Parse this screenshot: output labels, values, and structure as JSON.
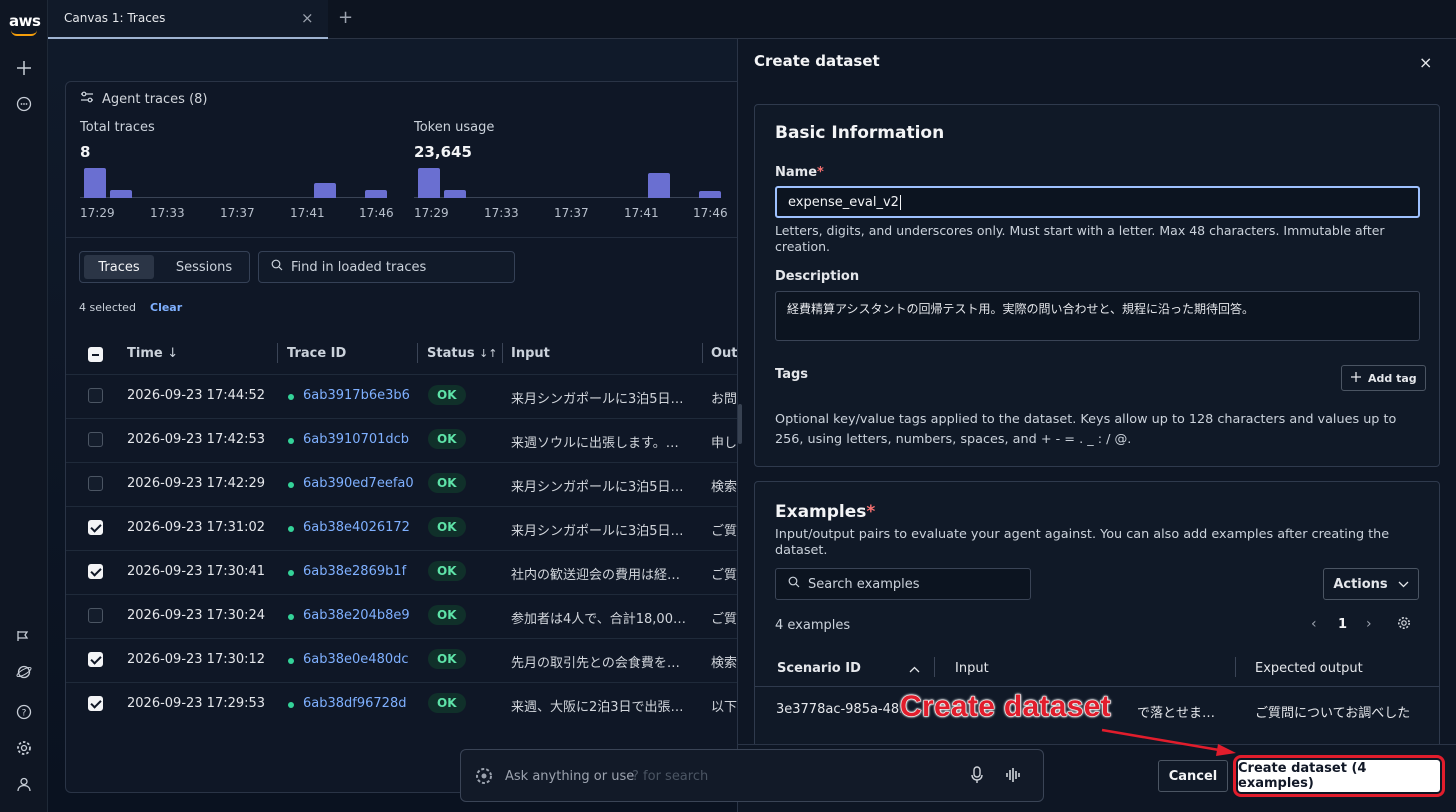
{
  "rail": {
    "logo": "aws",
    "icons": [
      "plus-icon",
      "chat-icon",
      "announce-icon",
      "support-icon",
      "help-icon",
      "settings-icon",
      "user-icon"
    ]
  },
  "tabbar": {
    "tab_title": "Canvas 1: Traces",
    "close": "×",
    "add": "+"
  },
  "traces_panel": {
    "title": "Agent traces (8)",
    "kpis": [
      {
        "label": "Total traces",
        "value": "8"
      },
      {
        "label": "Token usage",
        "value": "23,645"
      }
    ],
    "ticks": [
      "17:29",
      "17:33",
      "17:37",
      "17:41",
      "17:46"
    ],
    "segments": [
      "Traces",
      "Sessions"
    ],
    "search_placeholder": "Find in loaded traces",
    "selected_text": "4 selected",
    "clear_label": "Clear",
    "columns": {
      "time": "Time",
      "trace_id": "Trace ID",
      "status": "Status",
      "input": "Input",
      "output": "Outpu"
    },
    "rows": [
      {
        "time": "2026-09-23 17:44:52",
        "id": "6ab3917b6e3b6",
        "status": "OK",
        "input": "来月シンガポールに3泊5日…",
        "output": "お問",
        "checked": false
      },
      {
        "time": "2026-09-23 17:42:53",
        "id": "6ab3910701dcb",
        "status": "OK",
        "input": "来週ソウルに出張します。…",
        "output": "申し",
        "checked": false
      },
      {
        "time": "2026-09-23 17:42:29",
        "id": "6ab390ed7eefa0",
        "status": "OK",
        "input": "来月シンガポールに3泊5日…",
        "output": "検索",
        "checked": false
      },
      {
        "time": "2026-09-23 17:31:02",
        "id": "6ab38e4026172",
        "status": "OK",
        "input": "来月シンガポールに3泊5日…",
        "output": "ご質",
        "checked": true
      },
      {
        "time": "2026-09-23 17:30:41",
        "id": "6ab38e2869b1f",
        "status": "OK",
        "input": "社内の歓送迎会の費用は経…",
        "output": "ご質",
        "checked": true
      },
      {
        "time": "2026-09-23 17:30:24",
        "id": "6ab38e204b8e9",
        "status": "OK",
        "input": "参加者は4人で、合計18,000…",
        "output": "ご質",
        "checked": false
      },
      {
        "time": "2026-09-23 17:30:12",
        "id": "6ab38e0e480dc",
        "status": "OK",
        "input": "先月の取引先との会食費を…",
        "output": "検索",
        "checked": true
      },
      {
        "time": "2026-09-23 17:29:53",
        "id": "6ab38df96728d",
        "status": "OK",
        "input": "来週、大阪に2泊3日で出張…",
        "output": "以下",
        "checked": true
      }
    ]
  },
  "chart_data": [
    {
      "type": "bar",
      "title": "Total traces",
      "categories": [
        "17:29",
        "17:30",
        "17:41",
        "17:46"
      ],
      "values": [
        4,
        1,
        2,
        1
      ]
    },
    {
      "type": "bar",
      "title": "Token usage",
      "categories": [
        "17:29",
        "17:30",
        "17:41",
        "17:46"
      ],
      "values": [
        9500,
        2600,
        8000,
        2100
      ]
    }
  ],
  "dialog": {
    "title": "Create dataset",
    "close": "×",
    "basic": {
      "heading": "Basic Information",
      "name_label": "Name",
      "required_mark": "*",
      "name_value": "expense_eval_v2",
      "name_hint": "Letters, digits, and underscores only. Must start with a letter. Max 48 characters. Immutable after creation.",
      "description_label": "Description",
      "description_value": "経費精算アシスタントの回帰テスト用。実際の問い合わせと、規程に沿った期待回答。",
      "tags_label": "Tags",
      "add_tag_label": "Add tag",
      "tags_hint": "Optional key/value tags applied to the dataset. Keys allow up to 128 characters and values up to 256, using letters, numbers, spaces, and + - = . _ : / @."
    },
    "examples": {
      "heading": "Examples",
      "required_mark": "*",
      "subtitle": "Input/output pairs to evaluate your agent against. You can also add examples after creating the dataset.",
      "search_placeholder": "Search examples",
      "actions_label": "Actions",
      "count_text": "4 examples",
      "page": "1",
      "columns": {
        "scenario": "Scenario ID",
        "input": "Input",
        "expected": "Expected output"
      },
      "rows": [
        {
          "scenario": "3e3778ac-985a-48…",
          "input": "で落とせま…",
          "expected": "ご質問についてお調べした"
        }
      ]
    },
    "footer": {
      "cancel_label": "Cancel",
      "create_label": "Create dataset (4 examples)"
    }
  },
  "chat": {
    "placeholder": "Ask anything or use",
    "placeholder_hint": "? for search"
  },
  "annotation": {
    "text": "Create dataset",
    "color": "#e11d2c"
  }
}
